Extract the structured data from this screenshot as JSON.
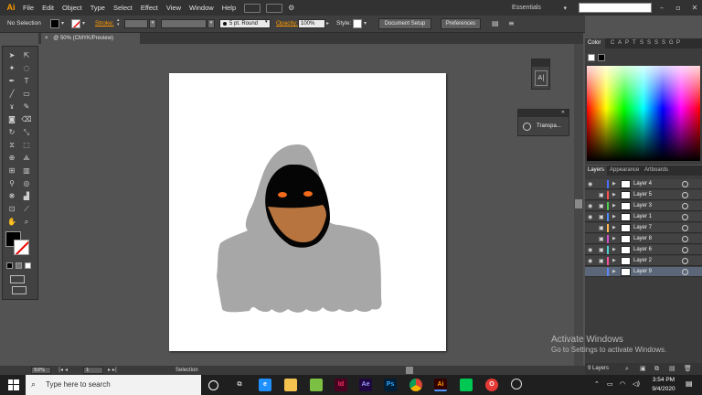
{
  "app": {
    "logo": "Ai",
    "menu": [
      "File",
      "Edit",
      "Object",
      "Type",
      "Select",
      "Effect",
      "View",
      "Window",
      "Help"
    ],
    "workspace": "Essentials"
  },
  "control_bar": {
    "selection": "No Selection",
    "stroke_label": "Stroke:",
    "stroke_preset": "5 pt. Round",
    "opacity_label": "Opacity:",
    "opacity_value": "100%",
    "style_label": "Style:",
    "document_setup": "Document Setup",
    "preferences": "Preferences"
  },
  "document": {
    "tab_label": "@ 50% (CMYK/Preview)",
    "tab_close": "×"
  },
  "panels": {
    "character_glyph": "A|",
    "transparency_label": "Transpa..."
  },
  "color_panel": {
    "tabs": [
      "Color",
      "C",
      "A",
      "P",
      "T",
      "S",
      "S",
      "S",
      "S",
      "G",
      "P"
    ]
  },
  "layers_panel": {
    "tabs": [
      "Layers",
      "Appearance",
      "Artboards"
    ],
    "layers": [
      {
        "name": "Layer 4",
        "visible": true,
        "locked": false,
        "color": "#4f6fff",
        "selected": false
      },
      {
        "name": "Layer 5",
        "visible": false,
        "locked": true,
        "color": "#ff4f4f",
        "selected": false
      },
      {
        "name": "Layer 3",
        "visible": true,
        "locked": true,
        "color": "#4fd04f",
        "selected": false
      },
      {
        "name": "Layer 1",
        "visible": true,
        "locked": true,
        "color": "#4f8bff",
        "selected": false
      },
      {
        "name": "Layer 7",
        "visible": false,
        "locked": true,
        "color": "#ffb84f",
        "selected": false
      },
      {
        "name": "Layer 8",
        "visible": false,
        "locked": true,
        "color": "#d04fd0",
        "selected": false
      },
      {
        "name": "Layer 6",
        "visible": true,
        "locked": true,
        "color": "#4fd0d0",
        "selected": false
      },
      {
        "name": "Layer 2",
        "visible": true,
        "locked": true,
        "color": "#ff4fa0",
        "selected": false
      },
      {
        "name": "Layer 9",
        "visible": false,
        "locked": false,
        "color": "#5f87ff",
        "selected": true
      }
    ],
    "footer_count": "9 Layers"
  },
  "status": {
    "zoom": "50%",
    "page": "1",
    "tool": "Selection"
  },
  "watermark": {
    "title": "Activate Windows",
    "subtitle": "Go to Settings to activate Windows."
  },
  "taskbar": {
    "search_placeholder": "Type here to search",
    "time": "3:54 PM",
    "date": "9/4/2020"
  },
  "colors": {
    "fill_swatch": "#000000",
    "hood": "#a7a7a7",
    "face_shadow": "#050505",
    "face": "#b8743f",
    "eyes": "#f26a1b"
  }
}
